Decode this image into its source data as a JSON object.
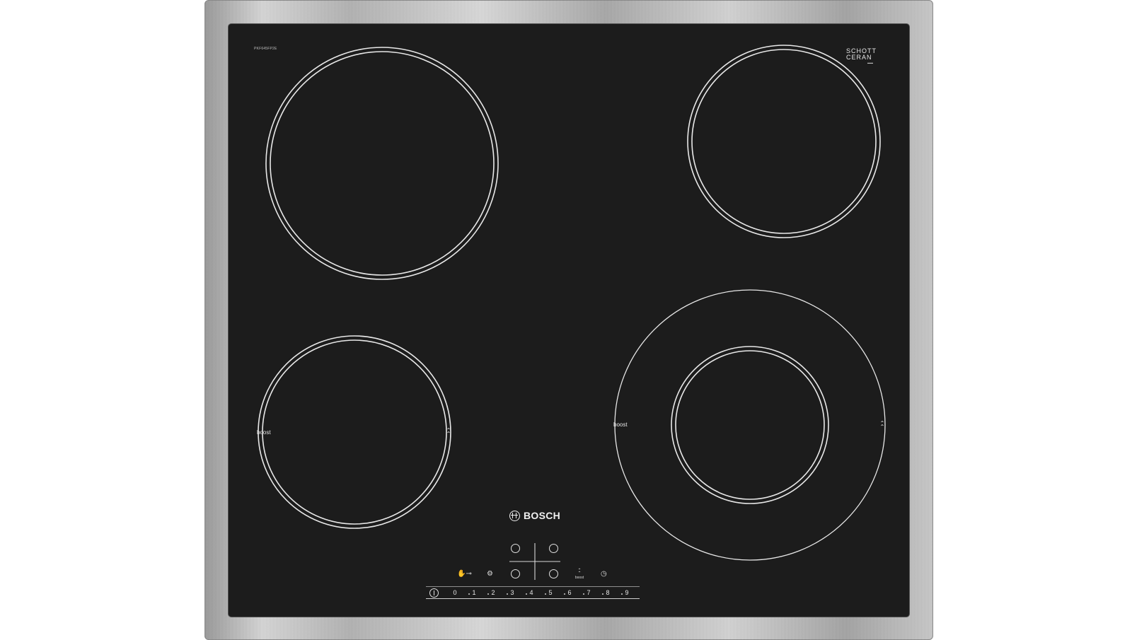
{
  "product": {
    "model_code": "PKF645FP2E",
    "glass_brand_line1": "SCHOTT",
    "glass_brand_line2": "CERAN",
    "brand_name": "BOSCH"
  },
  "zones": {
    "front_left_label": "boost",
    "front_right_label": "boost"
  },
  "controls": {
    "boost_key_label": "boost",
    "childlock_icon": "hand-key-icon",
    "basic_settings_icon": "gear-icon",
    "timer_icon": "clock-icon",
    "power_icon": "power-icon"
  },
  "slider": {
    "levels": [
      "0",
      "1",
      "2",
      "3",
      "4",
      "5",
      "6",
      "7",
      "8",
      "9"
    ]
  },
  "colors": {
    "glass": "#1c1c1c",
    "markings": "#e6e6e6",
    "frame": "#c4c4c4"
  }
}
